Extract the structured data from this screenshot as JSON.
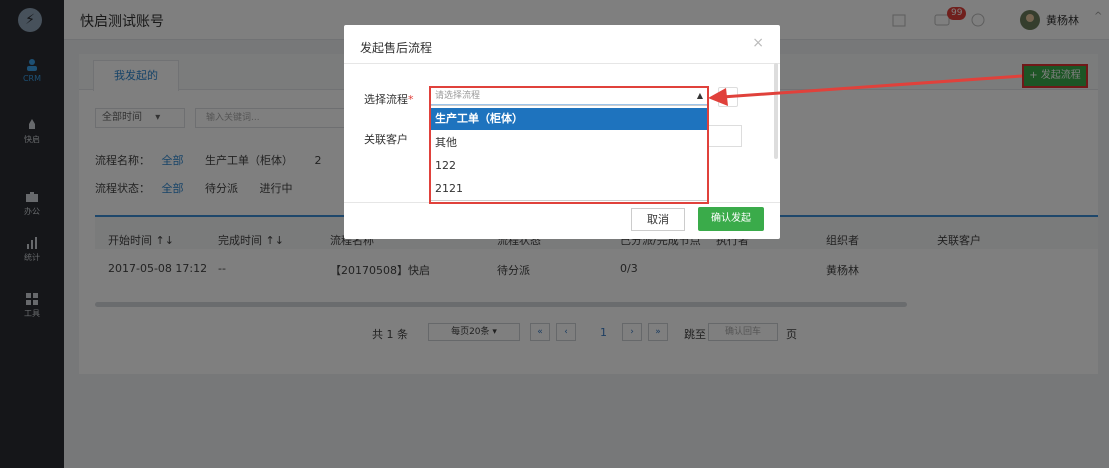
{
  "app": {
    "account_name": "快启测试账号",
    "user_name": "黄杨林",
    "notif_count": "99"
  },
  "sidebar": {
    "items": [
      {
        "label": "CRM",
        "icon": "crm-icon"
      },
      {
        "label": "快启",
        "icon": "rocket-icon"
      },
      {
        "label": "办公",
        "icon": "briefcase-icon"
      },
      {
        "label": "统计",
        "icon": "chart-icon"
      },
      {
        "label": "工具",
        "icon": "grid-icon"
      }
    ]
  },
  "main": {
    "tab_label": "我发起的",
    "start_button": "+ 发起流程",
    "time_filter": "全部时间",
    "keyword_placeholder": "输入关键词...",
    "flow_name_label": "流程名称：",
    "flow_name_options": [
      "全部",
      "生产工单（柜体）",
      "2"
    ],
    "flow_status_label": "流程状态：",
    "flow_status_options": [
      "全部",
      "待分派",
      "进行中"
    ],
    "columns": [
      "开始时间 ↑↓",
      "完成时间 ↑↓",
      "流程名称",
      "流程状态",
      "已分派/完成节点",
      "执行者",
      "组织者",
      "关联客户"
    ],
    "row": [
      "2017-05-08 17:12",
      "--",
      "【20170508】快启",
      "待分派",
      "0/3",
      "",
      "黄杨林",
      ""
    ],
    "pager": {
      "total": "共 1 条",
      "per_page": "每页20条",
      "page": "1",
      "jump_label": "跳至",
      "jump_placeholder": "确认回车",
      "page_unit": "页"
    }
  },
  "modal": {
    "title": "发起售后流程",
    "flow_label": "选择流程",
    "flow_placeholder": "请选择流程",
    "customer_label": "关联客户",
    "options": [
      "生产工单（柜体）",
      "其他",
      "122",
      "2121"
    ],
    "cancel": "取消",
    "confirm": "确认发起"
  },
  "colors": {
    "accent": "#3aab4a",
    "link": "#2f88d1",
    "highlight": "#e0413b"
  }
}
